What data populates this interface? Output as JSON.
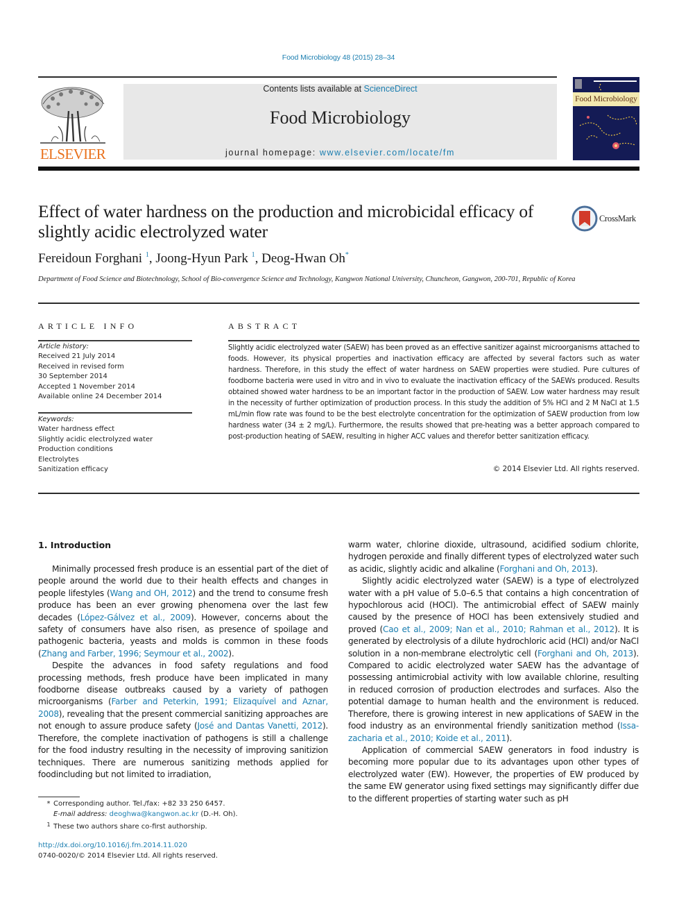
{
  "journal_reference": "Food Microbiology 48 (2015) 28–34",
  "header": {
    "publisher_logo_text": "ELSEVIER",
    "contents_prefix": "Contents lists available at ",
    "contents_link": "ScienceDirect",
    "journal_title": "Food Microbiology",
    "homepage_prefix": "journal homepage: ",
    "homepage_link": "www.elsevier.com/locate/fm",
    "cover_title": "Food Microbiology"
  },
  "article": {
    "title": "Effect of water hardness on the production and microbicidal efficacy of slightly acidic electrolyzed water",
    "crossmark_label": "CrossMark",
    "authors": [
      {
        "name": "Fereidoun Forghani",
        "mark": "1"
      },
      {
        "name": "Joong-Hyun Park",
        "mark": "1"
      },
      {
        "name": "Deog-Hwan Oh",
        "mark": "*"
      }
    ],
    "affiliation": "Department of Food Science and Biotechnology, School of Bio-convergence Science and Technology, Kangwon National University, Chuncheon, Gangwon, 200-701, Republic of Korea"
  },
  "article_info": {
    "heading": "ARTICLE INFO",
    "history_label": "Article history:",
    "history": [
      "Received 21 July 2014",
      "Received in revised form",
      "30 September 2014",
      "Accepted 1 November 2014",
      "Available online 24 December 2014"
    ],
    "keywords_label": "Keywords:",
    "keywords": [
      "Water hardness effect",
      "Slightly acidic electrolyzed water",
      "Production conditions",
      "Electrolytes",
      "Sanitization efficacy"
    ]
  },
  "abstract": {
    "heading": "ABSTRACT",
    "text": "Slightly acidic electrolyzed water (SAEW) has been proved as an effective sanitizer against microorganisms attached to foods. However, its physical properties and inactivation efficacy are affected by several factors such as water hardness. Therefore, in this study the effect of water hardness on SAEW properties were studied. Pure cultures of foodborne bacteria were used in vitro and in vivo to evaluate the inactivation efficacy of the SAEWs produced. Results obtained showed water hardness to be an important factor in the production of SAEW. Low water hardness may result in the necessity of further optimization of production process. In this study the addition of 5% HCl and 2 M NaCl at 1.5 mL/min flow rate was found to be the best electrolyte concentration for the optimization of SAEW production from low hardness water (34 ± 2 mg/L). Furthermore, the results showed that pre-heating was a better approach compared to post-production heating of SAEW, resulting in higher ACC values and therefor better sanitization efficacy.",
    "copyright": "© 2014 Elsevier Ltd. All rights reserved."
  },
  "introduction": {
    "heading": "1.  Introduction",
    "left_paragraphs": [
      [
        {
          "t": "Minimally processed fresh produce is an essential part of the diet of people around the world due to their health effects and changes in people lifestyles "
        },
        {
          "t": "(",
          "x": 1
        },
        {
          "t": "Wang and OH, 2012",
          "link": true
        },
        {
          "t": ") and the trend to consume fresh produce has been an ever growing phenomena over the last few decades ("
        },
        {
          "t": "López-Gálvez et al., 2009",
          "link": true
        },
        {
          "t": "). However, concerns about the safety of consumers have also risen, as presence of spoilage and pathogenic bacteria, yeasts and molds is common in these foods ("
        },
        {
          "t": "Zhang and Farber, 1996; Seymour et al., 2002",
          "link": true
        },
        {
          "t": ")."
        }
      ],
      [
        {
          "t": "Despite the advances in food safety regulations and food processing methods, fresh produce have been implicated in many foodborne disease outbreaks caused by a variety of pathogen microorganisms ("
        },
        {
          "t": "Farber and Peterkin, 1991; Elizaquível and Aznar, 2008",
          "link": true
        },
        {
          "t": "), revealing that the present commercial sanitizing approaches are not enough to assure produce safety ("
        },
        {
          "t": "José and Dantas Vanetti, 2012",
          "link": true
        },
        {
          "t": "). Therefore, the complete inactivation of pathogens is still a challenge for the food industry resulting in the necessity of improving sanitizion techniques. There are numerous sanitizing methods applied for foodincluding but not limited to irradiation,"
        }
      ]
    ],
    "right_paragraphs": [
      {
        "indent": false,
        "runs": [
          {
            "t": "warm water, chlorine dioxide, ultrasound, acidified sodium chlorite, hydrogen peroxide and finally different types of electrolyzed water such as acidic, slightly acidic and alkaline ("
          },
          {
            "t": "Forghani and Oh, 2013",
            "link": true
          },
          {
            "t": ")."
          }
        ]
      },
      {
        "indent": true,
        "runs": [
          {
            "t": "Slightly acidic electrolyzed water (SAEW) is a type of electrolyzed water with a pH value of 5.0–6.5 that contains a high concentration of hypochlorous acid (HOCl). The antimicrobial effect of SAEW mainly caused by the presence of HOCl has been extensively studied and proved ("
          },
          {
            "t": "Cao et al., 2009; Nan et al., 2010; Rahman et al., 2012",
            "link": true
          },
          {
            "t": "). It is generated by electrolysis of a dilute hydrochloric acid (HCl) and/or NaCl solution in a non-membrane electrolytic cell ("
          },
          {
            "t": "Forghani and Oh, 2013",
            "link": true
          },
          {
            "t": "). Compared to acidic electrolyzed water SAEW has the advantage of possessing antimicrobial activity with low available chlorine, resulting in reduced corrosion of production electrodes and surfaces. Also the potential damage to human health and the environment is reduced. Therefore, there is growing interest in new applications of SAEW in the food industry as an environmental friendly sanitization method ("
          },
          {
            "t": "Issa-zacharia et al., 2010; Koide et al., 2011",
            "link": true
          },
          {
            "t": ")."
          }
        ]
      },
      {
        "indent": true,
        "runs": [
          {
            "t": "Application of commercial SAEW generators in food industry is becoming more popular due to its advantages upon other types of electrolyzed water (EW). However, the properties of EW produced by the same EW generator using fixed settings may significantly differ due to the different properties of starting water such as pH"
          }
        ]
      }
    ]
  },
  "footnotes": {
    "corresponding_mark": "*",
    "corresponding_text": "Corresponding author. Tel./fax: +82 33 250 6457.",
    "email_label": "E-mail address:",
    "email": "deoghwa@kangwon.ac.kr",
    "email_suffix": " (D.-H. Oh).",
    "cofirst_mark": "1",
    "cofirst_text": "These two authors share co-first authorship.",
    "doi": "http://dx.doi.org/10.1016/j.fm.2014.11.020",
    "issn_line": "0740-0020/© 2014 Elsevier Ltd. All rights reserved."
  },
  "colors": {
    "link": "#1b7eb0",
    "elsevier_orange": "#e9711c",
    "header_box": "#e8e8e8"
  }
}
